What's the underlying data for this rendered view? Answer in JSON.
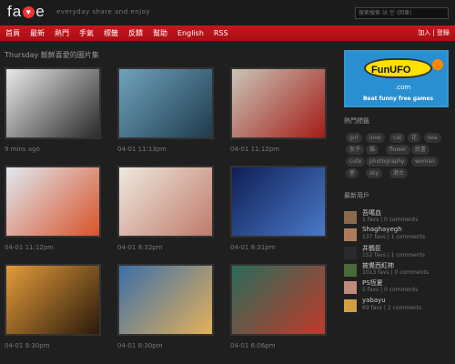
{
  "header": {
    "logo_pre": "fa",
    "logo_heart": "♥",
    "logo_post": "e",
    "tagline": "everyday share and enjoy",
    "search_placeholder": "搜索搜索 站 空 (回車)"
  },
  "nav": {
    "items": [
      "首頁",
      "最新",
      "熱門",
      "手氣",
      "標籤",
      "反饋",
      "幫助",
      "English",
      "RSS"
    ],
    "login": "加入",
    "sep": " | ",
    "signup": "登錄"
  },
  "main": {
    "section_title": "Thursday 飯鮮喜愛的圖片集",
    "photos": [
      {
        "caption": "9 mins ago",
        "colors": [
          "#e8e8e8",
          "#2a2a2a"
        ]
      },
      {
        "caption": "04-01 11:13pm",
        "colors": [
          "#6fa3bd",
          "#1f3b4d"
        ]
      },
      {
        "caption": "04-01 11:12pm",
        "colors": [
          "#c9c5b7",
          "#a41c17"
        ]
      },
      {
        "caption": "04-01 11:12pm",
        "colors": [
          "#e0e9f0",
          "#d9532a"
        ]
      },
      {
        "caption": "04-01 8:32pm",
        "colors": [
          "#eee9de",
          "#c07a6a"
        ]
      },
      {
        "caption": "04-01 8:31pm",
        "colors": [
          "#0f1f56",
          "#4a79c8"
        ]
      },
      {
        "caption": "04-01 8:30pm",
        "colors": [
          "#e49b3a",
          "#2a1a0a"
        ]
      },
      {
        "caption": "04-01 8:30pm",
        "colors": [
          "#3b6fa8",
          "#e3b05a"
        ]
      },
      {
        "caption": "04-01 6:06pm",
        "colors": [
          "#2a6b5a",
          "#c03a2a"
        ]
      }
    ]
  },
  "sidebar": {
    "ad": {
      "brand": "FunUFO",
      "dotcom": ".com",
      "slogan": "Beat funny free games"
    },
    "tags_title": "熱門標籤",
    "tags": [
      "girl",
      "love",
      "cat",
      "花",
      "sea",
      "女子",
      "貓",
      "flower",
      "民書",
      "cute",
      "photography",
      "woman",
      "愛",
      "sky",
      "港台"
    ],
    "users_title": "最新用戶",
    "users": [
      {
        "name": "吾噶血",
        "stats": "1 favs | 0 comments",
        "color": "#8a6a4a"
      },
      {
        "name": "Shaghayegh",
        "stats": "137 favs | 1 comments",
        "color": "#b07a5a"
      },
      {
        "name": "井鶴臣",
        "stats": "152 favs | 1 comments",
        "color": "#2a2a2a"
      },
      {
        "name": "披覺西紅柿",
        "stats": "1013 favs | 0 comments",
        "color": "#4a6a3a"
      },
      {
        "name": "PS恆夏",
        "stats": "5 favs | 0 comments",
        "color": "#c08a7a"
      },
      {
        "name": "yabayu",
        "stats": "69 favs | 2 comments",
        "color": "#d0a040"
      }
    ]
  }
}
